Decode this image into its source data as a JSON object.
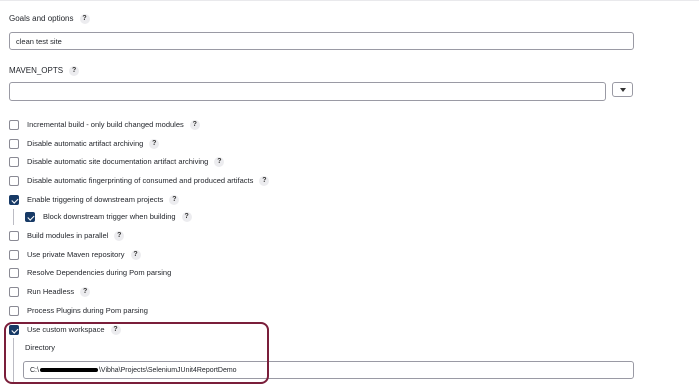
{
  "goals": {
    "label": "Goals and options",
    "value": "clean test site"
  },
  "maven_opts": {
    "label": "MAVEN_OPTS",
    "value": ""
  },
  "help_glyph": "?",
  "options": [
    {
      "label": "Incremental build - only build changed modules",
      "checked": false,
      "help": true
    },
    {
      "label": "Disable automatic artifact archiving",
      "checked": false,
      "help": true
    },
    {
      "label": "Disable automatic site documentation artifact archiving",
      "checked": false,
      "help": true
    },
    {
      "label": "Disable automatic fingerprinting of consumed and produced artifacts",
      "checked": false,
      "help": true
    },
    {
      "label": "Enable triggering of downstream projects",
      "checked": true,
      "help": true
    },
    {
      "label": "Block downstream trigger when building",
      "checked": true,
      "help": true,
      "nested": true
    },
    {
      "label": "Build modules in parallel",
      "checked": false,
      "help": true
    },
    {
      "label": "Use private Maven repository",
      "checked": false,
      "help": true
    },
    {
      "label": "Resolve Dependencies during Pom parsing",
      "checked": false,
      "help": false
    },
    {
      "label": "Run Headless",
      "checked": false,
      "help": true
    },
    {
      "label": "Process Plugins during Pom parsing",
      "checked": false,
      "help": false
    },
    {
      "label": "Use custom workspace",
      "checked": true,
      "help": true
    }
  ],
  "custom_workspace": {
    "directory_label": "Directory",
    "path_prefix": "C:\\",
    "path_suffix": "\\Vibha\\Projects\\SeleniumJUnit4ReportDemo"
  },
  "colors": {
    "checked": "#173a66",
    "highlight": "#7a1e3a"
  }
}
